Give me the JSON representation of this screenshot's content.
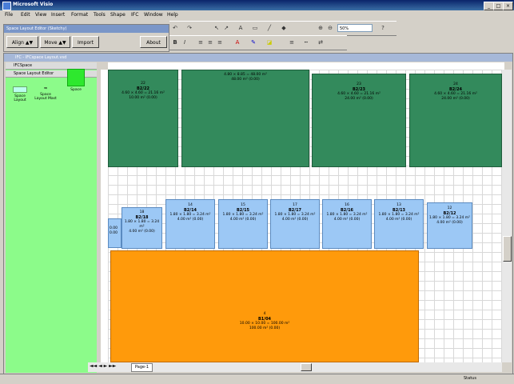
{
  "window": {
    "title": "Microsoft Visio",
    "min": "_",
    "max": "□",
    "close": "×"
  },
  "menu": [
    "File",
    "Edit",
    "View",
    "Insert",
    "Format",
    "Tools",
    "Shape",
    "IFC",
    "Window",
    "Help"
  ],
  "toolbar": {
    "zoom": "50%"
  },
  "space_editor": {
    "title": "Space Layout Editor (Sketchy)",
    "buttons": {
      "align": "Align",
      "move": "Move",
      "import": "Import",
      "about": "About"
    }
  },
  "document": {
    "title": "IFC - IFCspace Layout.vsd",
    "page_tab": "Page-1"
  },
  "shapes_panel": {
    "rows": [
      "IFCSpace",
      "Space Layout Editor"
    ],
    "stencils": [
      "Space Layout",
      "Space Layout Mast",
      "Space"
    ]
  },
  "spaces": [
    {
      "num": "22",
      "id": "B2/22",
      "l1": "4.60 × 4.60 = 21.16 m²",
      "l2": "10.00 m² (0.00)",
      "color": "green"
    },
    {
      "num": "",
      "id": "",
      "l1": "4.80 × 8.85 = 48.00 m²",
      "l2": "48.00 m² (0.00)",
      "color": "green"
    },
    {
      "num": "23",
      "id": "B2/23",
      "l1": "4.60 × 4.60 = 21.16 m²",
      "l2": "24.00 m² (0.00)",
      "color": "green"
    },
    {
      "num": "24",
      "id": "B2/24",
      "l1": "4.60 × 4.60 = 21.16 m²",
      "l2": "24.00 m² (0.00)",
      "color": "green"
    },
    {
      "num": "",
      "id": "",
      "l1": "0.00",
      "l2": "0.00",
      "color": "blue"
    },
    {
      "num": "18",
      "id": "B2/18",
      "l1": "1.80 × 1.80 = 3.24 m²",
      "l2": "4.00 m² (0.00)",
      "color": "blue"
    },
    {
      "num": "14",
      "id": "B2/14",
      "l1": "1.80 × 1.80 = 3.24 m²",
      "l2": "4.00 m² (0.00)",
      "color": "blue"
    },
    {
      "num": "15",
      "id": "B2/15",
      "l1": "1.80 × 1.80 = 3.24 m²",
      "l2": "4.00 m² (0.00)",
      "color": "blue"
    },
    {
      "num": "17",
      "id": "B2/17",
      "l1": "1.80 × 1.80 = 3.24 m²",
      "l2": "4.00 m² (0.00)",
      "color": "blue"
    },
    {
      "num": "16",
      "id": "B2/16",
      "l1": "1.80 × 1.80 = 3.24 m²",
      "l2": "4.00 m² (0.00)",
      "color": "blue"
    },
    {
      "num": "13",
      "id": "B2/13",
      "l1": "1.80 × 1.80 = 3.24 m²",
      "l2": "4.00 m² (0.00)",
      "color": "blue"
    },
    {
      "num": "12",
      "id": "B2/12",
      "l1": "1.80 × 1.80 = 3.24 m²",
      "l2": "4.00 m² (0.00)",
      "color": "blue"
    },
    {
      "num": "4",
      "id": "B1/04",
      "l1": "10.00 × 10.00 = 100.00 m²",
      "l2": "100.00 m² (0.00)",
      "color": "orange"
    }
  ],
  "status": {
    "text": "Status"
  },
  "colors": {
    "green": "#338a5c",
    "blue": "#9cc8f5",
    "orange": "#ff9a0b",
    "stencil_bg": "#8cfb8a"
  }
}
